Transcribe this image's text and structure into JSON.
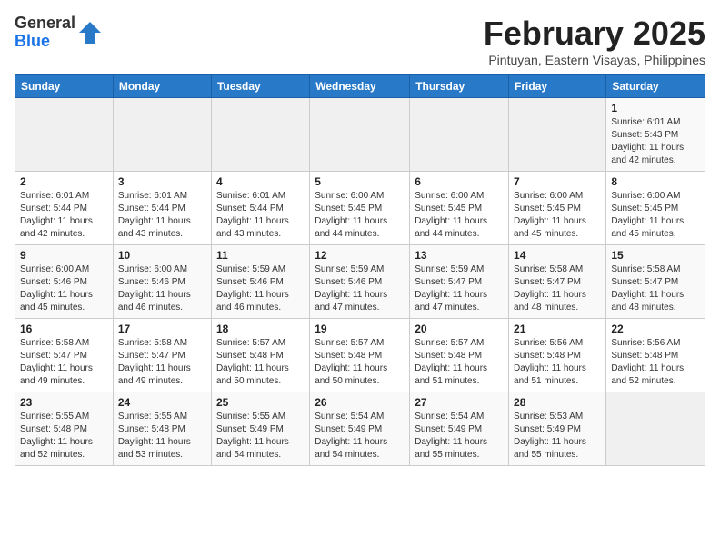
{
  "logo": {
    "general": "General",
    "blue": "Blue"
  },
  "title": "February 2025",
  "location": "Pintuyan, Eastern Visayas, Philippines",
  "days_of_week": [
    "Sunday",
    "Monday",
    "Tuesday",
    "Wednesday",
    "Thursday",
    "Friday",
    "Saturday"
  ],
  "weeks": [
    [
      {
        "day": "",
        "info": ""
      },
      {
        "day": "",
        "info": ""
      },
      {
        "day": "",
        "info": ""
      },
      {
        "day": "",
        "info": ""
      },
      {
        "day": "",
        "info": ""
      },
      {
        "day": "",
        "info": ""
      },
      {
        "day": "1",
        "info": "Sunrise: 6:01 AM\nSunset: 5:43 PM\nDaylight: 11 hours and 42 minutes."
      }
    ],
    [
      {
        "day": "2",
        "info": "Sunrise: 6:01 AM\nSunset: 5:44 PM\nDaylight: 11 hours and 42 minutes."
      },
      {
        "day": "3",
        "info": "Sunrise: 6:01 AM\nSunset: 5:44 PM\nDaylight: 11 hours and 43 minutes."
      },
      {
        "day": "4",
        "info": "Sunrise: 6:01 AM\nSunset: 5:44 PM\nDaylight: 11 hours and 43 minutes."
      },
      {
        "day": "5",
        "info": "Sunrise: 6:00 AM\nSunset: 5:45 PM\nDaylight: 11 hours and 44 minutes."
      },
      {
        "day": "6",
        "info": "Sunrise: 6:00 AM\nSunset: 5:45 PM\nDaylight: 11 hours and 44 minutes."
      },
      {
        "day": "7",
        "info": "Sunrise: 6:00 AM\nSunset: 5:45 PM\nDaylight: 11 hours and 45 minutes."
      },
      {
        "day": "8",
        "info": "Sunrise: 6:00 AM\nSunset: 5:45 PM\nDaylight: 11 hours and 45 minutes."
      }
    ],
    [
      {
        "day": "9",
        "info": "Sunrise: 6:00 AM\nSunset: 5:46 PM\nDaylight: 11 hours and 45 minutes."
      },
      {
        "day": "10",
        "info": "Sunrise: 6:00 AM\nSunset: 5:46 PM\nDaylight: 11 hours and 46 minutes."
      },
      {
        "day": "11",
        "info": "Sunrise: 5:59 AM\nSunset: 5:46 PM\nDaylight: 11 hours and 46 minutes."
      },
      {
        "day": "12",
        "info": "Sunrise: 5:59 AM\nSunset: 5:46 PM\nDaylight: 11 hours and 47 minutes."
      },
      {
        "day": "13",
        "info": "Sunrise: 5:59 AM\nSunset: 5:47 PM\nDaylight: 11 hours and 47 minutes."
      },
      {
        "day": "14",
        "info": "Sunrise: 5:58 AM\nSunset: 5:47 PM\nDaylight: 11 hours and 48 minutes."
      },
      {
        "day": "15",
        "info": "Sunrise: 5:58 AM\nSunset: 5:47 PM\nDaylight: 11 hours and 48 minutes."
      }
    ],
    [
      {
        "day": "16",
        "info": "Sunrise: 5:58 AM\nSunset: 5:47 PM\nDaylight: 11 hours and 49 minutes."
      },
      {
        "day": "17",
        "info": "Sunrise: 5:58 AM\nSunset: 5:47 PM\nDaylight: 11 hours and 49 minutes."
      },
      {
        "day": "18",
        "info": "Sunrise: 5:57 AM\nSunset: 5:48 PM\nDaylight: 11 hours and 50 minutes."
      },
      {
        "day": "19",
        "info": "Sunrise: 5:57 AM\nSunset: 5:48 PM\nDaylight: 11 hours and 50 minutes."
      },
      {
        "day": "20",
        "info": "Sunrise: 5:57 AM\nSunset: 5:48 PM\nDaylight: 11 hours and 51 minutes."
      },
      {
        "day": "21",
        "info": "Sunrise: 5:56 AM\nSunset: 5:48 PM\nDaylight: 11 hours and 51 minutes."
      },
      {
        "day": "22",
        "info": "Sunrise: 5:56 AM\nSunset: 5:48 PM\nDaylight: 11 hours and 52 minutes."
      }
    ],
    [
      {
        "day": "23",
        "info": "Sunrise: 5:55 AM\nSunset: 5:48 PM\nDaylight: 11 hours and 52 minutes."
      },
      {
        "day": "24",
        "info": "Sunrise: 5:55 AM\nSunset: 5:48 PM\nDaylight: 11 hours and 53 minutes."
      },
      {
        "day": "25",
        "info": "Sunrise: 5:55 AM\nSunset: 5:49 PM\nDaylight: 11 hours and 54 minutes."
      },
      {
        "day": "26",
        "info": "Sunrise: 5:54 AM\nSunset: 5:49 PM\nDaylight: 11 hours and 54 minutes."
      },
      {
        "day": "27",
        "info": "Sunrise: 5:54 AM\nSunset: 5:49 PM\nDaylight: 11 hours and 55 minutes."
      },
      {
        "day": "28",
        "info": "Sunrise: 5:53 AM\nSunset: 5:49 PM\nDaylight: 11 hours and 55 minutes."
      },
      {
        "day": "",
        "info": ""
      }
    ]
  ]
}
